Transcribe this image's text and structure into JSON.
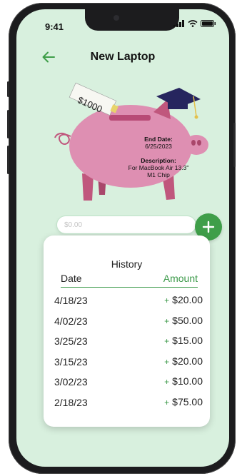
{
  "status": {
    "time": "9:41",
    "icons": [
      "signal-icon",
      "wifi-icon",
      "battery-icon"
    ]
  },
  "header": {
    "title": "New Laptop",
    "back_icon": "arrow-left-icon"
  },
  "goal": {
    "tag_label": "$1000",
    "end_date_label": "End Date:",
    "end_date": "6/25/2023",
    "description_label": "Description:",
    "description_line1": "For MacBook Air 13.3\"",
    "description_line2": "M1 Chip"
  },
  "amount_input": {
    "placeholder": "$0.00",
    "value": ""
  },
  "add_button_icon": "plus-icon",
  "history": {
    "title": "History",
    "col_date": "Date",
    "col_amount": "Amount",
    "plus_sign": "+",
    "rows": [
      {
        "date": "4/18/23",
        "amount": "$20.00"
      },
      {
        "date": "4/02/23",
        "amount": "$50.00"
      },
      {
        "date": "3/25/23",
        "amount": "$15.00"
      },
      {
        "date": "3/15/23",
        "amount": "$20.00"
      },
      {
        "date": "3/02/23",
        "amount": "$10.00"
      },
      {
        "date": "2/18/23",
        "amount": "$75.00"
      }
    ]
  },
  "colors": {
    "background": "#d8f0de",
    "accent": "#3f9e49",
    "pig": "#de8fb2",
    "cap": "#26255e"
  }
}
